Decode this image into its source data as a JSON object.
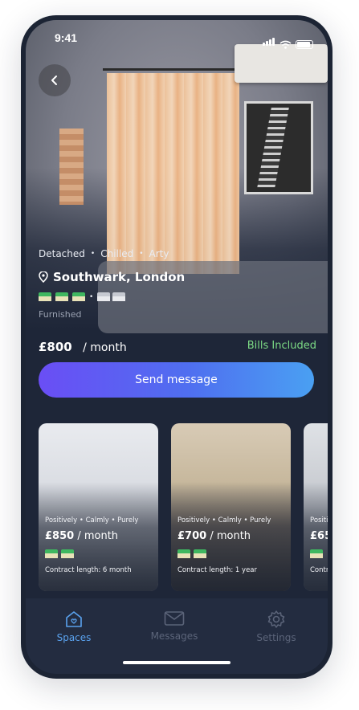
{
  "status_bar": {
    "time": "9:41"
  },
  "listing": {
    "tags": [
      "Detached",
      "Chilled",
      "Arty"
    ],
    "location": "Southwark, London",
    "furnished": "Furnished",
    "price": "£800",
    "period": "/ month",
    "bills": "Bills Included",
    "send_label": "Send message",
    "beds_total": 3,
    "baths_total": 2
  },
  "cards": [
    {
      "tags": "Positively  • Calmly • Purely",
      "price": "£850",
      "period": " / month",
      "contract": "Contract length: 6 month"
    },
    {
      "tags": "Positively  • Calmly • Purely",
      "price": "£700",
      "period": " / month",
      "contract": "Contract length: 1 year"
    },
    {
      "tags": "Positively  • Calmly • Purely",
      "price": "£65",
      "period": "",
      "contract": "Contr"
    }
  ],
  "tabs": [
    {
      "label": "Spaces",
      "icon": "home-icon",
      "active": true
    },
    {
      "label": "Messages",
      "icon": "mail-icon",
      "active": false
    },
    {
      "label": "Settings",
      "icon": "gear-icon",
      "active": false
    }
  ],
  "colors": {
    "accent_start": "#6a4ef5",
    "accent_end": "#4aa0f2",
    "bills_green": "#7ddc86",
    "active_tab": "#5aa2ee"
  }
}
